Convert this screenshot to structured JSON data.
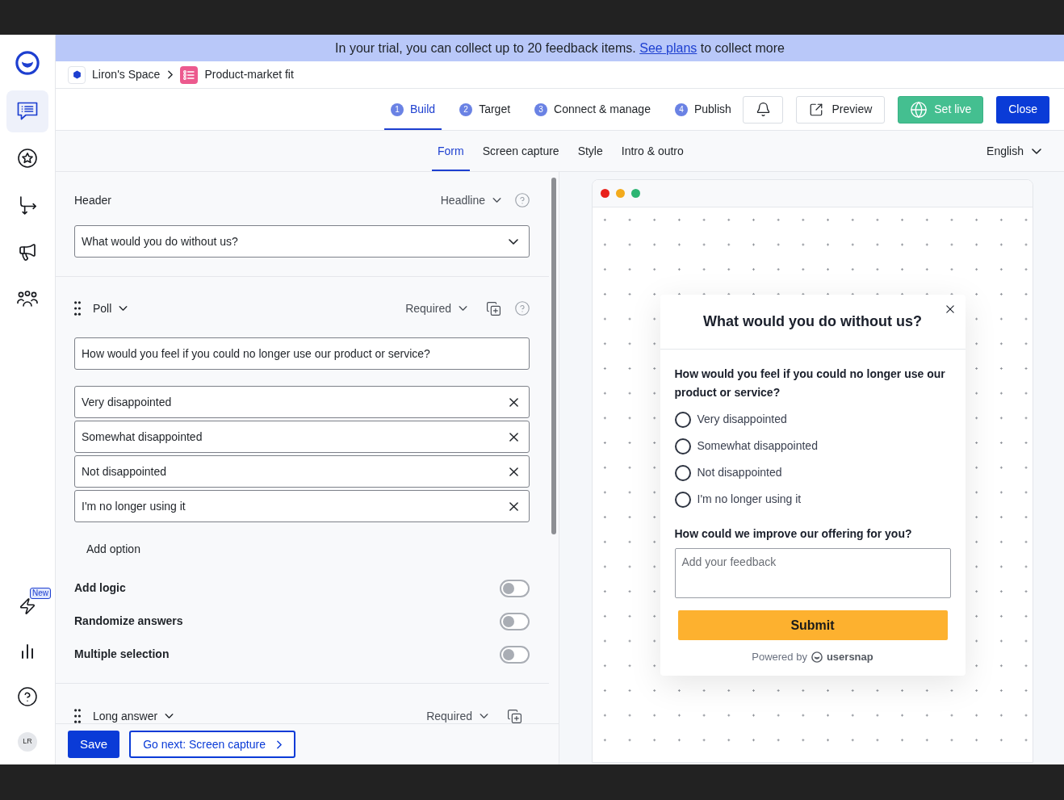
{
  "banner": {
    "text": "In your trial, you can collect up to 20 feedback items.",
    "link": "See plans",
    "text_after": "to collect more"
  },
  "sidebar": {
    "top_items": [
      {
        "selected": true
      },
      {
        "selected": false
      },
      {
        "selected": false
      },
      {
        "selected": false
      },
      {
        "selected": false
      }
    ],
    "bottom_items": [
      {
        "selected": false,
        "badge": "New"
      },
      {
        "selected": false
      },
      {
        "selected": false
      }
    ],
    "avatar": "LR"
  },
  "breadcrumb": [
    {
      "label": "Liron's Space"
    },
    {
      "label": "Product-market fit"
    }
  ],
  "steps": [
    {
      "number": "1",
      "label": "Build",
      "selected": true
    },
    {
      "number": "2",
      "label": "Target",
      "selected": false
    },
    {
      "number": "3",
      "label": "Connect & manage",
      "selected": false
    },
    {
      "number": "4",
      "label": "Publish",
      "selected": false
    }
  ],
  "actions": {
    "preview": "Preview",
    "set_live": "Set live",
    "close": "Close"
  },
  "section_tabs": [
    {
      "label": "Form",
      "selected": true
    },
    {
      "label": "Screen capture",
      "selected": false
    },
    {
      "label": "Style",
      "selected": false
    },
    {
      "label": "Intro & outro",
      "selected": false
    }
  ],
  "language": "English",
  "form": {
    "header": {
      "label": "Header",
      "style": "Headline",
      "value": "What would you do without us?"
    },
    "questions": [
      {
        "kind": "poll",
        "type": "Poll",
        "required": "Required",
        "question": "How would you feel if you could no longer use our product or service?",
        "options": [
          "Very disappointed",
          "Somewhat disappointed",
          "Not disappointed",
          "I'm no longer using it"
        ],
        "add_option": "Add option",
        "settings": [
          {
            "label": "Add logic",
            "on": false
          },
          {
            "label": "Randomize answers",
            "on": false
          },
          {
            "label": "Multiple selection",
            "on": false
          }
        ]
      },
      {
        "kind": "long_answer",
        "type": "Long answer",
        "required": "Required"
      }
    ]
  },
  "footer": {
    "save": "Save",
    "next": "Go next: Screen capture"
  },
  "preview": {
    "title": "What would you do without us?",
    "questions": [
      {
        "kind": "poll",
        "text": "How would you feel if you could no longer use our product or service?",
        "options": [
          {
            "label": "Very disappointed",
            "selected": false
          },
          {
            "label": "Somewhat disappointed",
            "selected": false
          },
          {
            "label": "Not disappointed",
            "selected": false
          },
          {
            "label": "I'm no longer using it",
            "selected": false
          }
        ]
      },
      {
        "kind": "long_answer",
        "text": "How could we improve our offering for you?",
        "placeholder": "Add your feedback"
      }
    ],
    "submit": "Submit",
    "powered_by": "Powered by",
    "brand": "usersnap"
  }
}
